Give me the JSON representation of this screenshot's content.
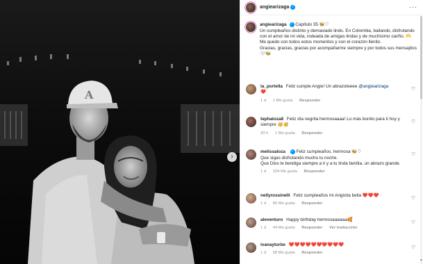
{
  "post": {
    "username": "angiearizaga",
    "caption_parts": [
      "Capítulo 35 🐝♡",
      "Un cumpleaños distinto y demasiado lindo. En Colombia, bailando, disfrutando con el amor de mi vida, rodeada de amigas lindas y de muchísimo cariño. 🫶",
      "Me quedo con todos estos momentos y con el corazón llenito.",
      "Gracias, gracias, gracias por acompañarme siempre y por todos sus mensajitos 🤍🐝"
    ],
    "more_icon": "more-options-icon",
    "next_icon": "chevron-right-icon"
  },
  "comments": [
    {
      "username": "la_portella",
      "text": "Feliz cumple Angie! Un abrazoteeee",
      "mention": "@angiearizaga",
      "line2": "❤️",
      "time": "1 d",
      "likes": "1 Me gusta",
      "reply": "Responder"
    },
    {
      "username": "tephaloza8",
      "text": "Feliz día negrita hermosaaaa! Lo más bonito para ti hoy y siempre 🥳🥳",
      "time": "20 h",
      "likes": "1 Me gusta",
      "reply": "Responder"
    },
    {
      "username": "melissaloza",
      "text": "Feliz cumpleaños, hermosa 🐝♡",
      "line2": "Que sigas disfrutando mucho tu noche.",
      "line3": "Que Dios te bendiga siempre a ti y a tu linda familia, un abrazo grande.",
      "time": "1 d",
      "likes": "104 Me gusta",
      "reply": "Responder"
    },
    {
      "username": "nellyrossinelli",
      "text": "Feliz cumpleaños mi Angicita bella ❤️❤️❤️",
      "time": "1 d",
      "likes": "66 Me gusta",
      "reply": "Responder"
    },
    {
      "username": "aleventuro",
      "text": "Happy birthday hermosaaaaaa🥰",
      "time": "1 d",
      "likes": "44 Me gusta",
      "reply": "Responder",
      "translate": "Ver traducción"
    },
    {
      "username": "ivanayturbe",
      "text": "❤️❤️❤️❤️❤️❤️❤️❤️❤️❤️",
      "time": "1 d",
      "likes": "58 Me gusta",
      "reply": "Responder"
    }
  ],
  "colors": {
    "verified": "#0095f6",
    "heart": "#ed4956",
    "muted": "#8e8e8e"
  }
}
